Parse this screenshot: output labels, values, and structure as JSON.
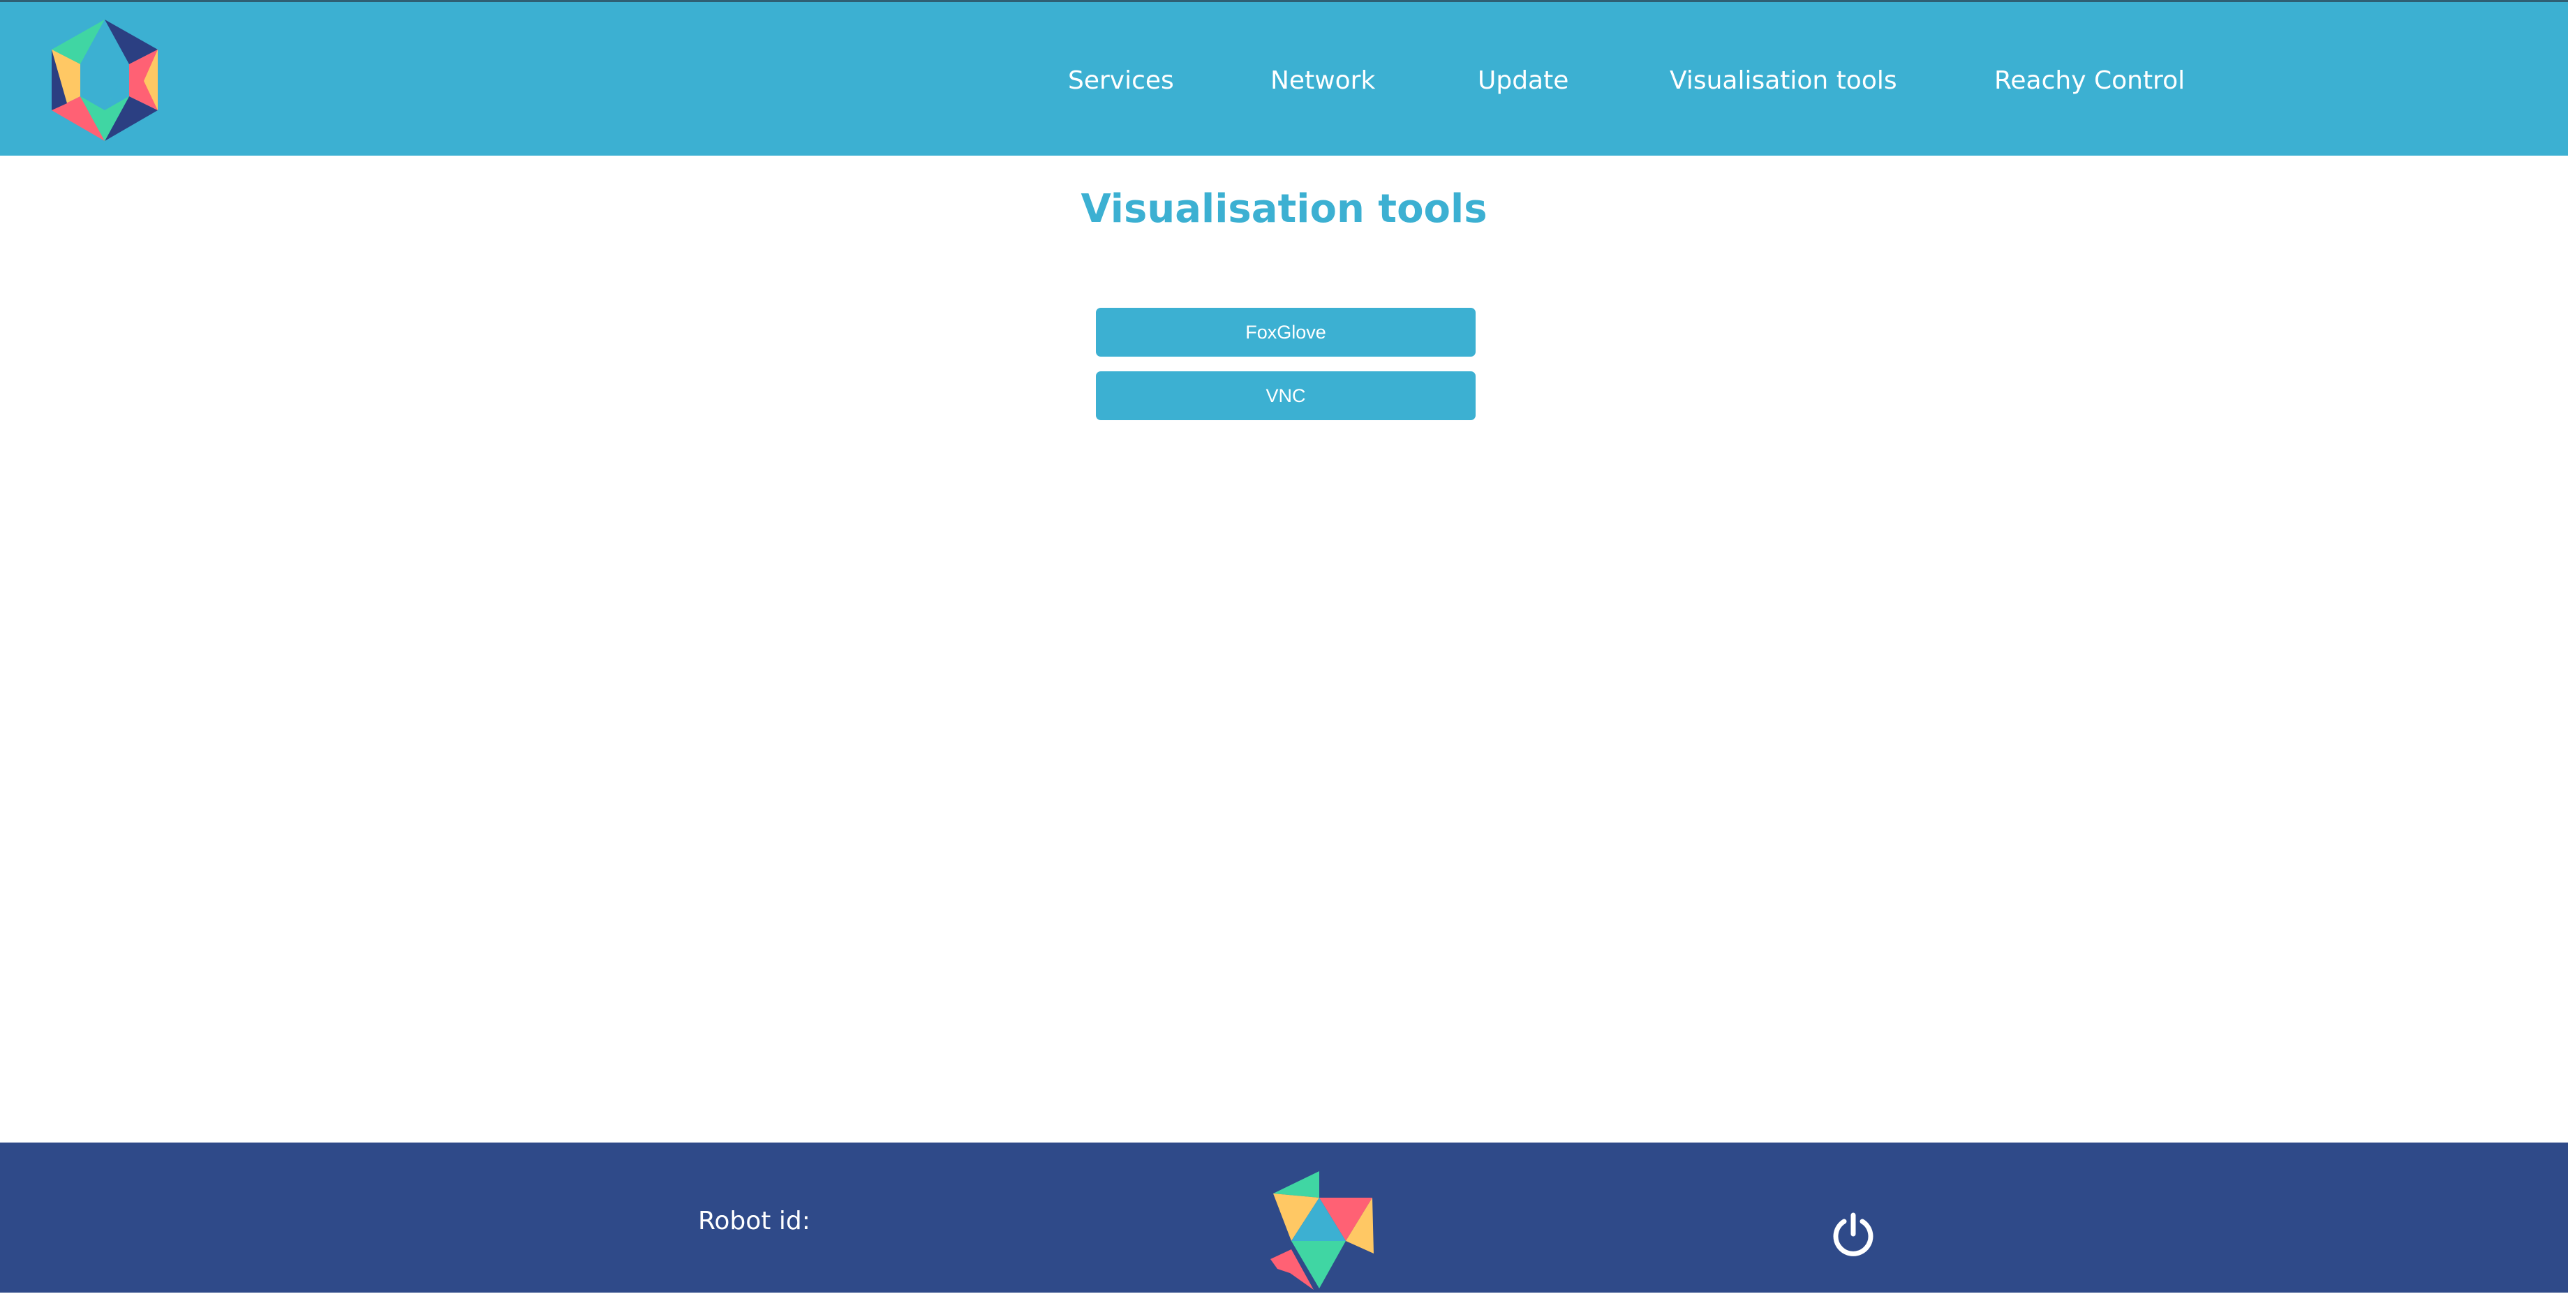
{
  "header": {
    "logo_icon": "reachy-hexagon-logo-icon",
    "nav": [
      {
        "label": "Services"
      },
      {
        "label": "Network"
      },
      {
        "label": "Update"
      },
      {
        "label": "Visualisation tools"
      },
      {
        "label": "Reachy Control"
      }
    ]
  },
  "main": {
    "title": "Visualisation tools",
    "buttons": [
      {
        "label": "FoxGlove"
      },
      {
        "label": "VNC"
      }
    ]
  },
  "footer": {
    "robot_id_label": "Robot id:",
    "logo_icon": "pollen-robotics-logo-icon",
    "power_icon": "power-icon"
  },
  "colors": {
    "primary": "#3cb0d2",
    "footer_background": "#2f4a89",
    "logo_teal": "#40d6a3",
    "logo_red": "#ff6174",
    "logo_yellow": "#ffc864",
    "logo_navy": "#2b3f82",
    "logo_blue": "#3cb0d2"
  }
}
